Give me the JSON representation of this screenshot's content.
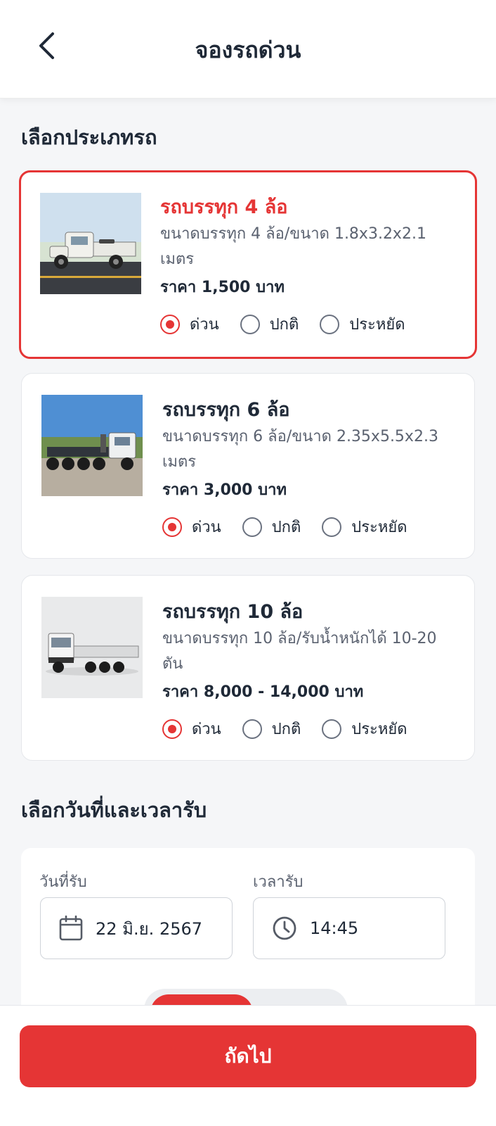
{
  "header": {
    "title": "จองรถด่วน",
    "back_icon": "chevron-left-icon"
  },
  "vehicle_section": {
    "title": "เลือกประเภทรถ"
  },
  "vehicles": [
    {
      "name": "รถบรรทุก 4 ล้อ",
      "desc": "ขนาดบรรทุก 4 ล้อ/ขนาด 1.8x3.2x2.1 เมตร",
      "price": "ราคา 1,500 บาท",
      "selected": true,
      "options": [
        "ด่วน",
        "ปกติ",
        "ประหยัด"
      ],
      "selected_option": "ด่วน"
    },
    {
      "name": "รถบรรทุก 6 ล้อ",
      "desc": "ขนาดบรรทุก 6 ล้อ/ขนาด 2.35x5.5x2.3 เมตร",
      "price": "ราคา 3,000 บาท",
      "selected": false,
      "options": [
        "ด่วน",
        "ปกติ",
        "ประหยัด"
      ],
      "selected_option": "ด่วน"
    },
    {
      "name": "รถบรรทุก 10 ล้อ",
      "desc": "ขนาดบรรทุก 10 ล้อ/รับน้ำหนักได้ 10-20 ตัน",
      "price": "ราคา 8,000 - 14,000 บาท",
      "selected": false,
      "options": [
        "ด่วน",
        "ปกติ",
        "ประหยัด"
      ],
      "selected_option": "ด่วน"
    }
  ],
  "datetime_section": {
    "title": "เลือกวันที่และเวลารับ",
    "date_label": "วันที่รับ",
    "date_value": "22 มิ.ย. 2567",
    "date_icon": "calendar-icon",
    "time_label": "เวลารับ",
    "time_value": "14:45",
    "time_icon": "clock-icon"
  },
  "footer": {
    "next_label": "ถัดไป"
  },
  "colors": {
    "accent": "#e53535",
    "text": "#1f2937",
    "muted": "#5b6270",
    "background": "#f5f6f8"
  }
}
